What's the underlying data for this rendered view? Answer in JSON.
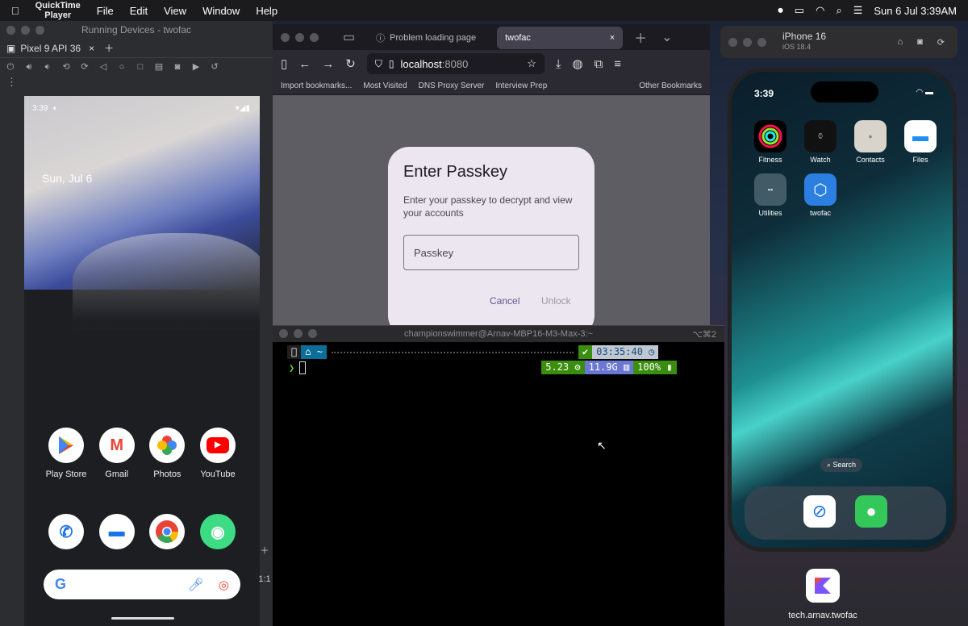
{
  "menubar": {
    "app_name": "QuickTime Player",
    "menus": [
      "File",
      "Edit",
      "View",
      "Window",
      "Help"
    ],
    "datetime": "Sun 6 Jul  3:39AM"
  },
  "emulator": {
    "window_title": "Running Devices - twofac",
    "device_tab": "Pixel 9 API 36",
    "status_time": "3:39",
    "date_widget": "Sun, Jul 6",
    "apps_row1": [
      "Play Store",
      "Gmail",
      "Photos",
      "YouTube"
    ],
    "side_label": "1:1"
  },
  "firefox": {
    "tabs": [
      "Problem loading page",
      "twofac"
    ],
    "url_host": "localhost",
    "url_port": ":8080",
    "bookmarks": [
      "Import bookmarks...",
      "Most Visited",
      "DNS Proxy Server",
      "Interview Prep",
      "Other Bookmarks"
    ]
  },
  "dialog": {
    "title": "Enter Passkey",
    "text": "Enter your passkey to decrypt and view your accounts",
    "placeholder": "Passkey",
    "cancel": "Cancel",
    "unlock": "Unlock"
  },
  "terminal": {
    "title": "championswimmer@Arnav-MBP16-M3-Max-3:~",
    "shortcut": "⌥⌘2",
    "home_seg": "~",
    "time": "03:35:40",
    "load": "5.23",
    "mem": "11.9G",
    "battery": "100%"
  },
  "simulator": {
    "device": "iPhone 16",
    "os": "iOS 18.4",
    "time": "3:39",
    "apps_row1": [
      "Fitness",
      "Watch",
      "Contacts",
      "Files"
    ],
    "apps_row2": [
      "Utilities",
      "twofac"
    ],
    "search_pill": "Search",
    "dock_label": "tech.arnav.twofac"
  }
}
